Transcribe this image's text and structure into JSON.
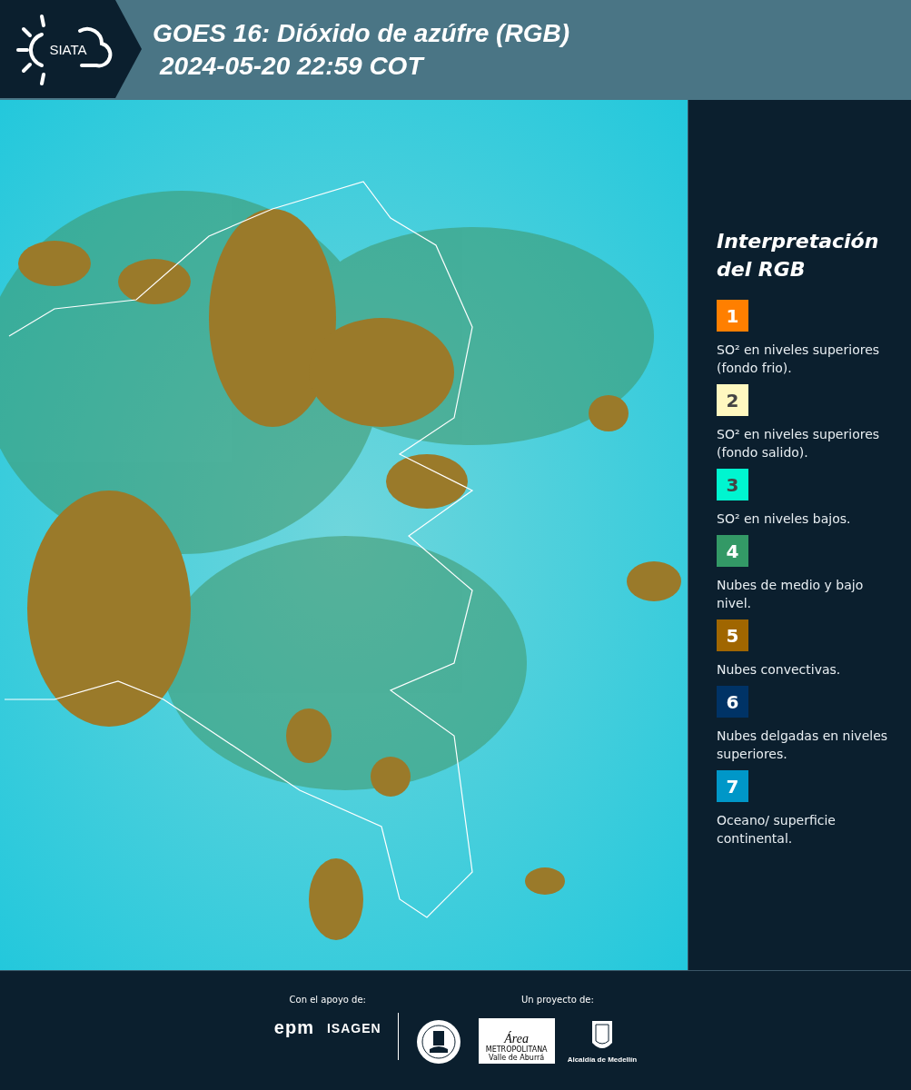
{
  "header": {
    "logo_text": "SIATA",
    "title": "GOES 16: Dióxido de azúfre (RGB)",
    "timestamp": "2024-05-20 22:59 COT"
  },
  "legend": {
    "title": "Interpretación del RGB",
    "items": [
      {
        "number": "1",
        "color": "#ff7f00",
        "description": "SO² en niveles superiores (fondo frio)."
      },
      {
        "number": "2",
        "color": "#fff8c0",
        "description": "SO² en niveles superiores (fondo salido)."
      },
      {
        "number": "3",
        "color": "#00f5d0",
        "description": "SO² en niveles bajos."
      },
      {
        "number": "4",
        "color": "#339966",
        "description": "Nubes de medio y bajo nivel."
      },
      {
        "number": "5",
        "color": "#a06600",
        "description": "Nubes convectivas."
      },
      {
        "number": "6",
        "color": "#003366",
        "description": "Nubes delgadas en niveles superiores."
      },
      {
        "number": "7",
        "color": "#0097c8",
        "description": "Oceano/ superficie continental."
      }
    ]
  },
  "footer": {
    "support_label": "Con el apoyo de:",
    "supporters": [
      "epm",
      "ISAGEN"
    ],
    "project_label": "Un proyecto de:",
    "area_logo": {
      "name": "Área",
      "line1": "METROPOLITANA",
      "line2": "Valle de Aburrá"
    },
    "alcaldia": "Alcaldía de Medellín"
  }
}
